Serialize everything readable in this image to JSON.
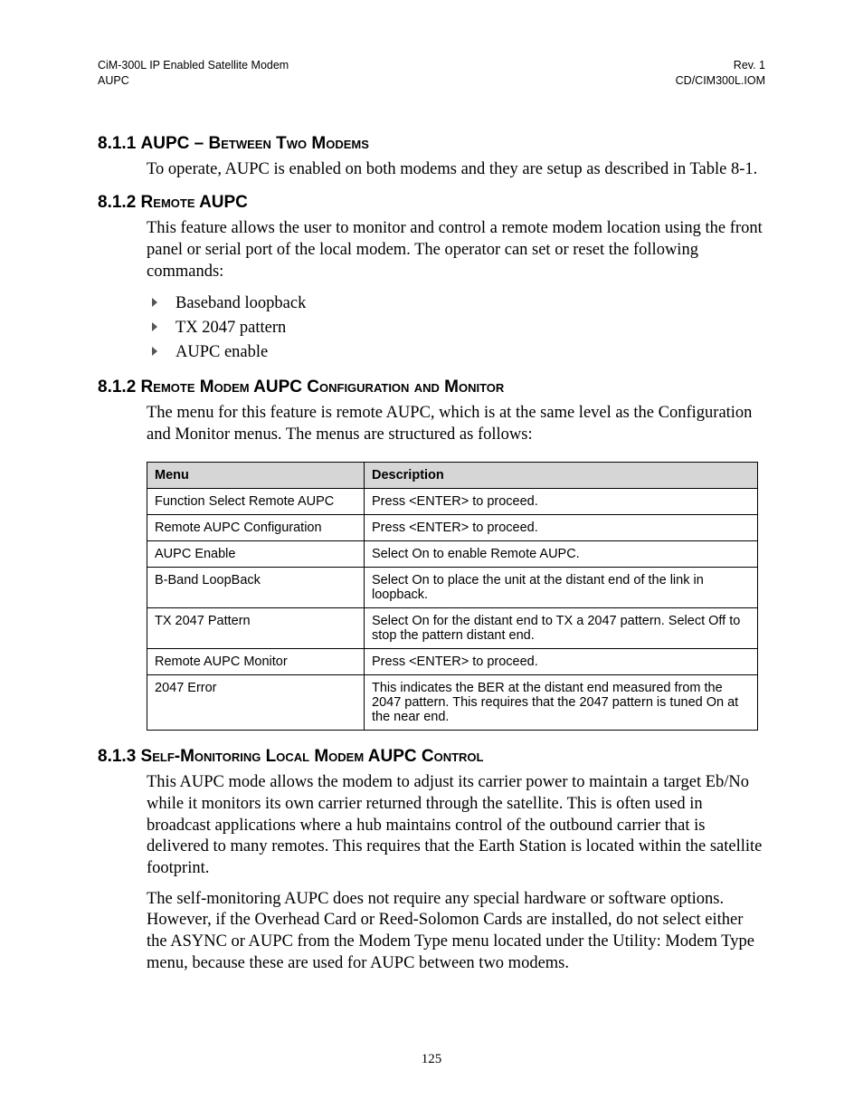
{
  "header": {
    "left_line1": "CiM-300L IP Enabled Satellite Modem",
    "left_line2": "AUPC",
    "right_line1": "Rev. 1",
    "right_line2": "CD/CIM300L.IOM"
  },
  "sections": {
    "s811": {
      "num": "8.1.1 ",
      "title": "AUPC – Between Two Modems",
      "para1": "To operate, AUPC is enabled on both modems and they are setup as described in Table 8-1."
    },
    "s812a": {
      "num": "8.1.2 ",
      "title": "Remote AUPC",
      "para1": "This feature allows the user to monitor and control a remote modem location using the front panel or serial port of the local modem. The operator can set or reset the following commands:",
      "bullets": [
        "Baseband loopback",
        "TX 2047 pattern",
        "AUPC enable"
      ]
    },
    "s812b": {
      "num": "8.1.2  ",
      "title": "Remote Modem AUPC Configuration and Monitor",
      "para1": "The menu for this feature is remote AUPC, which is at the same level as the Configuration and Monitor menus. The menus are structured as follows:"
    },
    "s813": {
      "num": "8.1.3 ",
      "title": "Self-Monitoring Local Modem AUPC Control",
      "para1": "This AUPC mode allows the modem to adjust its carrier power to maintain a target Eb/No while it monitors its own carrier returned through the satellite. This is often used in broadcast applications where a hub maintains control of the outbound carrier that is delivered to many remotes. This requires that the Earth Station is located within the satellite footprint.",
      "para2": "The self-monitoring AUPC does not require any special hardware or software options. However, if the Overhead Card or Reed-Solomon Cards are installed, do not select either the ASYNC or AUPC from the Modem Type menu located under the Utility: Modem Type menu, because these are used for AUPC between two modems."
    }
  },
  "table": {
    "headers": [
      "Menu",
      "Description"
    ],
    "rows": [
      {
        "menu": "Function Select Remote AUPC",
        "desc": "Press <ENTER> to proceed."
      },
      {
        "menu": "Remote AUPC Configuration",
        "desc": "Press <ENTER> to proceed."
      },
      {
        "menu": "AUPC Enable",
        "desc": "Select On to enable Remote AUPC."
      },
      {
        "menu": "B-Band LoopBack",
        "desc": "Select On to place the unit at the distant end of the link in loopback."
      },
      {
        "menu": "TX 2047 Pattern",
        "desc": "Select On for the distant end to TX a 2047 pattern. Select Off to stop the pattern distant end."
      },
      {
        "menu": "Remote AUPC Monitor",
        "desc": "Press <ENTER> to proceed."
      },
      {
        "menu": "2047 Error",
        "desc": "This indicates the BER at the distant end measured from the 2047 pattern. This requires that the 2047 pattern is tuned On at the near end."
      }
    ]
  },
  "page_number": "125"
}
